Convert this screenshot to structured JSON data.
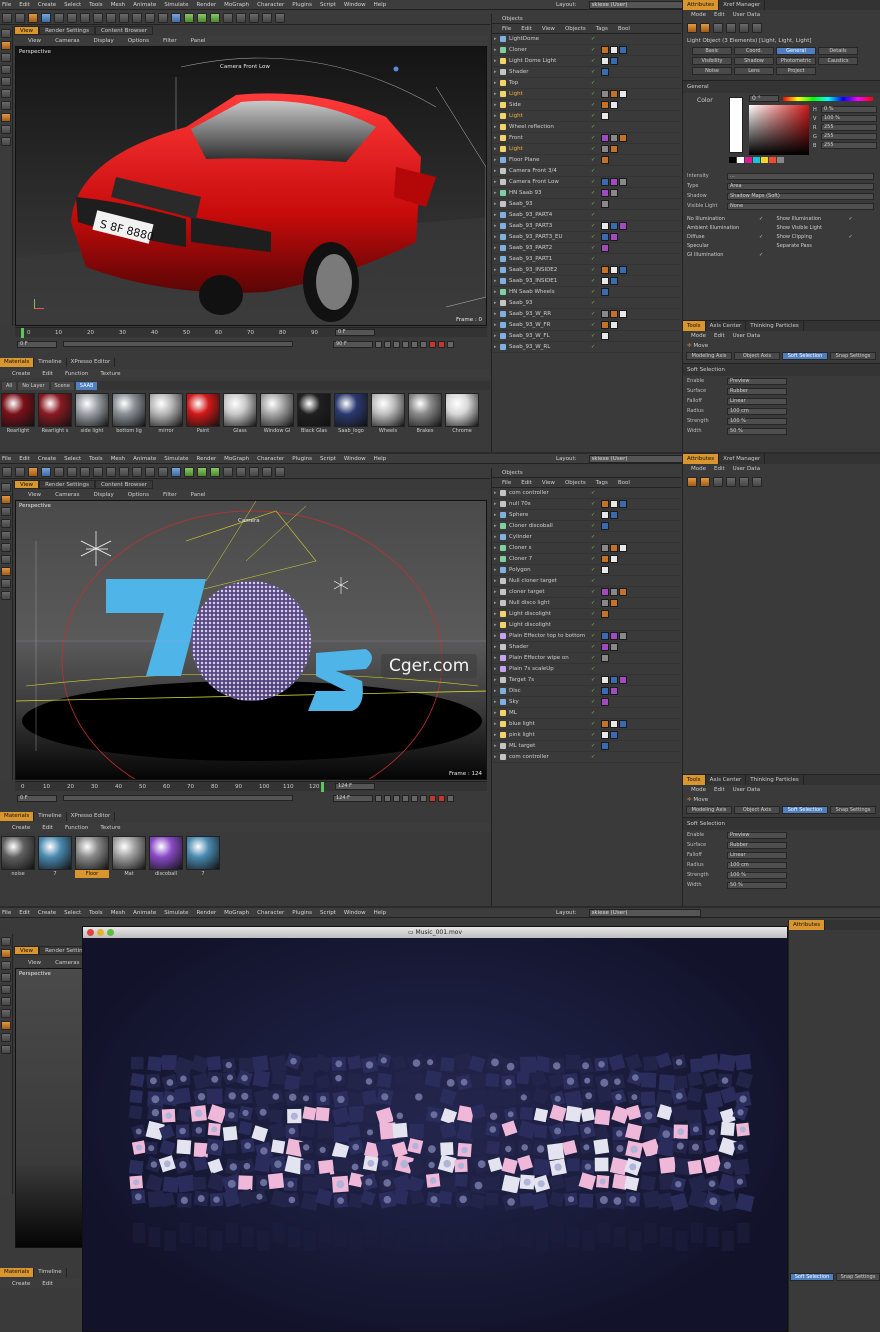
{
  "menu": [
    "File",
    "Edit",
    "Create",
    "Select",
    "Tools",
    "Mesh",
    "Animate",
    "Simulate",
    "Render",
    "MoGraph",
    "Character",
    "Plugins",
    "Script",
    "Window",
    "Help"
  ],
  "layout": {
    "label": "Layout:",
    "value": "skiexe (User)"
  },
  "view": {
    "tabs": [
      "View",
      "Render Settings",
      "Content Browser"
    ],
    "menu": [
      "View",
      "Cameras",
      "Display",
      "Options",
      "Filter",
      "Panel"
    ],
    "label": "Perspective"
  },
  "p1": {
    "camera": "Camera Front Low",
    "frame": "Frame : 0",
    "ticks": [
      "0",
      "10",
      "20",
      "30",
      "40",
      "50",
      "60",
      "70",
      "80",
      "90"
    ],
    "field_a": "0 F",
    "field_b": "90 F",
    "field_c": "0 F",
    "plate": "S 8F 8880",
    "objects": [
      {
        "name": "LightDome",
        "c": "#7fb0e0"
      },
      {
        "name": "Cloner",
        "c": "#7fd0a0"
      },
      {
        "name": "Light Dome Light",
        "c": "#f2d46a"
      },
      {
        "name": "Shader",
        "c": "#c4c4c4"
      },
      {
        "name": "Top",
        "c": "#f2d46a"
      },
      {
        "name": "Light",
        "c": "#f2d46a",
        "hl": true
      },
      {
        "name": "Side",
        "c": "#f2d46a"
      },
      {
        "name": "Light",
        "c": "#f2d46a",
        "hl": true
      },
      {
        "name": "Wheel reflection",
        "c": "#f2d46a"
      },
      {
        "name": "Front",
        "c": "#f2d46a"
      },
      {
        "name": "Light",
        "c": "#f2d46a",
        "hl": true
      },
      {
        "name": "Floor Plane",
        "c": "#7fb0e0"
      },
      {
        "name": "Camera Front 3/4",
        "c": "#c4c4c4"
      },
      {
        "name": "Camera Front Low",
        "c": "#c4c4c4"
      },
      {
        "name": "HN Saab 93",
        "c": "#7fd0a0"
      },
      {
        "name": "Saab_93",
        "c": "#c4c4c4"
      },
      {
        "name": "Saab_93_PART4",
        "c": "#7fb0e0"
      },
      {
        "name": "Saab_93_PART3",
        "c": "#7fb0e0"
      },
      {
        "name": "Saab_93_PART3_EU",
        "c": "#7fb0e0"
      },
      {
        "name": "Saab_93_PART2",
        "c": "#7fb0e0"
      },
      {
        "name": "Saab_93_PART1",
        "c": "#7fb0e0"
      },
      {
        "name": "Saab_93_INSIDE2",
        "c": "#7fb0e0"
      },
      {
        "name": "Saab_93_INSIDE1",
        "c": "#7fb0e0"
      },
      {
        "name": "HN Saab Wheels",
        "c": "#7fd0a0"
      },
      {
        "name": "Saab_93",
        "c": "#c4c4c4"
      },
      {
        "name": "Saab_93_W_RR",
        "c": "#7fb0e0"
      },
      {
        "name": "Saab_93_W_FR",
        "c": "#7fb0e0"
      },
      {
        "name": "Saab_93_W_FL",
        "c": "#7fb0e0"
      },
      {
        "name": "Saab_93_W_RL",
        "c": "#7fb0e0"
      }
    ],
    "mat_tabs": [
      "Materials",
      "Timeline",
      "XPresso Editor"
    ],
    "mat_menu": [
      "Create",
      "Edit",
      "Function",
      "Texture"
    ],
    "mat_filter": [
      "All",
      "No Layer",
      "Scene",
      "SAAB"
    ],
    "materials": [
      {
        "n": "Rearlight",
        "c": "#7a1018"
      },
      {
        "n": "Rearlight s",
        "c": "#8a1a22"
      },
      {
        "n": "side light",
        "c": "#9aa0a6"
      },
      {
        "n": "bottom lig",
        "c": "#8a9096"
      },
      {
        "n": "mirror",
        "c": "#b8b8b8"
      },
      {
        "n": "Paint",
        "c": "#d01818"
      },
      {
        "n": "Glass",
        "c": "#c8c8c8"
      },
      {
        "n": "Window Gl",
        "c": "#a8a8a8"
      },
      {
        "n": "Black Glas",
        "c": "#202020"
      },
      {
        "n": "Saab_logo",
        "c": "#2a3a70"
      },
      {
        "n": "Wheels",
        "c": "#c0c0c0"
      },
      {
        "n": "Brakes",
        "c": "#8a8a8a"
      },
      {
        "n": "Chrome",
        "c": "#d8d8d8"
      }
    ],
    "attr_tabs": [
      "Attributes",
      "Xref Manager"
    ],
    "attr_menu": [
      "Mode",
      "Edit",
      "User Data"
    ],
    "attr_title": "Light Object (3 Elements) [Light, Light, Light]",
    "attr_btns": [
      "Basic",
      "Coord.",
      "General",
      "Details",
      "Visibility",
      "Shadow",
      "Photometric",
      "Caustics",
      "Noise",
      "Lens",
      "Project"
    ],
    "general": "General",
    "color_label": "Color",
    "color_h": "0 °",
    "color_rgb": [
      {
        "k": "H",
        "v": "0 %"
      },
      {
        "k": "V",
        "v": "100 %"
      },
      {
        "k": "R",
        "v": "255"
      },
      {
        "k": "G",
        "v": "255"
      },
      {
        "k": "B",
        "v": "255"
      }
    ],
    "props": [
      {
        "k": "Intensity",
        "v": "..."
      },
      {
        "k": "Type",
        "v": "Area"
      },
      {
        "k": "Shadow",
        "v": "Shadow Maps (Soft)"
      },
      {
        "k": "Visible Light",
        "v": "None"
      }
    ],
    "checks_l": [
      "No Illumination",
      "Ambient Illumination",
      "Diffuse",
      "Specular",
      "GI Illumination"
    ],
    "checks_r": [
      "Show Illumination",
      "Show Visible Light",
      "Show Clipping",
      "Separate Pass"
    ],
    "tools_tabs": [
      "Tools",
      "Axis Center",
      "Thinking Particles"
    ],
    "tools_menu": [
      "Mode",
      "Edit",
      "User Data"
    ],
    "move": "Move",
    "tool_btns": [
      "Modeling Axis",
      "Object Axis",
      "Soft Selection",
      "Snap Settings"
    ],
    "soft": "Soft Selection",
    "soft_rows": [
      {
        "k": "Enable",
        "v": "Preview"
      },
      {
        "k": "Surface",
        "v": "Rubber"
      },
      {
        "k": "Falloff",
        "v": "Linear"
      },
      {
        "k": "Radius",
        "v": "100 cm"
      },
      {
        "k": "Strength",
        "v": "100 %"
      },
      {
        "k": "Width",
        "v": "50 %"
      }
    ]
  },
  "p2": {
    "camera": "Camera",
    "frame": "Frame : 124",
    "ticks": [
      "0",
      "10",
      "20",
      "30",
      "40",
      "50",
      "60",
      "70",
      "80",
      "90",
      "100",
      "110",
      "120"
    ],
    "field_a": "0 F",
    "field_b": "124 F",
    "field_c": "124 F",
    "watermark": "Cger.com",
    "objects": [
      {
        "name": "com controller",
        "c": "#c4c4c4"
      },
      {
        "name": "null 70s",
        "c": "#c4c4c4"
      },
      {
        "name": "Sphere",
        "c": "#7fb0e0"
      },
      {
        "name": "Cloner discoball",
        "c": "#7fd0a0"
      },
      {
        "name": "Cylinder",
        "c": "#7fb0e0"
      },
      {
        "name": "Cloner s",
        "c": "#7fd0a0"
      },
      {
        "name": "Cloner 7",
        "c": "#7fd0a0"
      },
      {
        "name": "Polygon",
        "c": "#7fb0e0"
      },
      {
        "name": "Null cloner target",
        "c": "#c4c4c4"
      },
      {
        "name": "cloner target",
        "c": "#c4c4c4"
      },
      {
        "name": "Null disco light",
        "c": "#c4c4c4"
      },
      {
        "name": "Light discolight",
        "c": "#f2d46a"
      },
      {
        "name": "Light discolight",
        "c": "#f2d46a"
      },
      {
        "name": "Plain Effector top to bottom",
        "c": "#c4a4f0"
      },
      {
        "name": "Shader",
        "c": "#c4c4c4"
      },
      {
        "name": "Plain Effector wipe on",
        "c": "#c4a4f0"
      },
      {
        "name": "Plain 7s scaleUp",
        "c": "#c4a4f0"
      },
      {
        "name": "Target 7s",
        "c": "#c4c4c4"
      },
      {
        "name": "Disc",
        "c": "#7fb0e0"
      },
      {
        "name": "Sky",
        "c": "#7fb0e0"
      },
      {
        "name": "ML",
        "c": "#f2d46a"
      },
      {
        "name": "blue light",
        "c": "#f2d46a"
      },
      {
        "name": "pink light",
        "c": "#f2d46a"
      },
      {
        "name": "ML target",
        "c": "#c4c4c4"
      },
      {
        "name": "com controller",
        "c": "#c4c4c4"
      }
    ],
    "materials": [
      {
        "n": "noise",
        "c": "#606060"
      },
      {
        "n": "7",
        "c": "#4a8ab0"
      },
      {
        "n": "Floor",
        "c": "#8a8a8a",
        "sel": true
      },
      {
        "n": "Mat",
        "c": "#a0a0a0"
      },
      {
        "n": "discoball",
        "c": "#8a4ac8"
      },
      {
        "n": "7",
        "c": "#4a8ab0"
      }
    ]
  },
  "p3": {
    "movie_title": "Music_001.mov"
  }
}
